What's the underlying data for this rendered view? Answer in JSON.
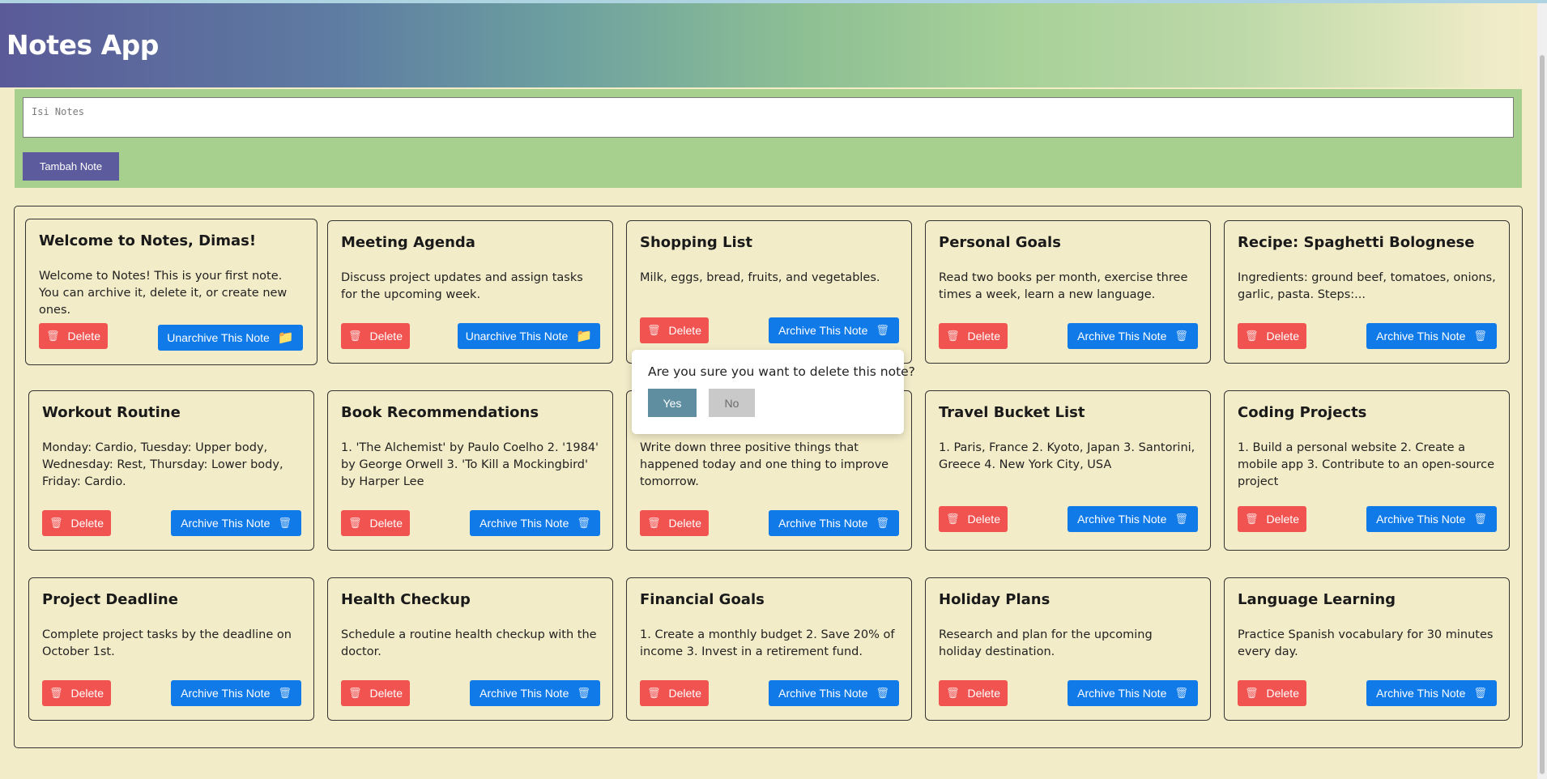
{
  "app": {
    "title": "Notes App"
  },
  "form": {
    "placeholder": "Isi Notes",
    "submit_label": "Tambah Note"
  },
  "labels": {
    "delete": "Delete",
    "archive": "Archive This Note",
    "unarchive": "Unarchive This Note"
  },
  "notes": [
    {
      "title": "Welcome to Notes, Dimas!",
      "body": "Welcome to Notes! This is your first note. You can archive it, delete it, or create new ones.",
      "archived": true
    },
    {
      "title": "Meeting Agenda",
      "body": "Discuss project updates and assign tasks for the upcoming week.",
      "archived": true
    },
    {
      "title": "Shopping List",
      "body": "Milk, eggs, bread, fruits, and vegetables.",
      "archived": false
    },
    {
      "title": "Personal Goals",
      "body": "Read two books per month, exercise three times a week, learn a new language.",
      "archived": false
    },
    {
      "title": "Recipe: Spaghetti Bolognese",
      "body": "Ingredients: ground beef, tomatoes, onions, garlic, pasta. Steps:...",
      "archived": false
    },
    {
      "title": "Workout Routine",
      "body": "Monday: Cardio, Tuesday: Upper body, Wednesday: Rest, Thursday: Lower body, Friday: Cardio.",
      "archived": false
    },
    {
      "title": "Book Recommendations",
      "body": "1. 'The Alchemist' by Paulo Coelho 2. '1984' by George Orwell 3. 'To Kill a Mockingbird' by Harper Lee",
      "archived": false
    },
    {
      "title": "",
      "body": "Write down three positive things that happened today and one thing to improve tomorrow.",
      "archived": false
    },
    {
      "title": "Travel Bucket List",
      "body": "1. Paris, France 2. Kyoto, Japan 3. Santorini, Greece 4. New York City, USA",
      "archived": false
    },
    {
      "title": "Coding Projects",
      "body": "1. Build a personal website 2. Create a mobile app 3. Contribute to an open-source project",
      "archived": false
    },
    {
      "title": "Project Deadline",
      "body": "Complete project tasks by the deadline on October 1st.",
      "archived": false
    },
    {
      "title": "Health Checkup",
      "body": "Schedule a routine health checkup with the doctor.",
      "archived": false
    },
    {
      "title": "Financial Goals",
      "body": "1. Create a monthly budget 2. Save 20% of income 3. Invest in a retirement fund.",
      "archived": false
    },
    {
      "title": "Holiday Plans",
      "body": "Research and plan for the upcoming holiday destination.",
      "archived": false
    },
    {
      "title": "Language Learning",
      "body": "Practice Spanish vocabulary for 30 minutes every day.",
      "archived": false
    }
  ],
  "confirm_dialog": {
    "message": "Are you sure you want to delete this note?",
    "yes_label": "Yes",
    "no_label": "No"
  },
  "icons": {
    "delete": "trash-icon",
    "archive": "trash-icon",
    "unarchive": "folder-icon"
  },
  "colors": {
    "background": "#f3ecc8",
    "form_background": "#a7cf8d",
    "submit_button": "#5b5b9d",
    "delete_button": "#f05350",
    "archive_button": "#0f7ae8",
    "dialog_yes": "#5f8ea0",
    "dialog_no": "#c9c9c9"
  }
}
